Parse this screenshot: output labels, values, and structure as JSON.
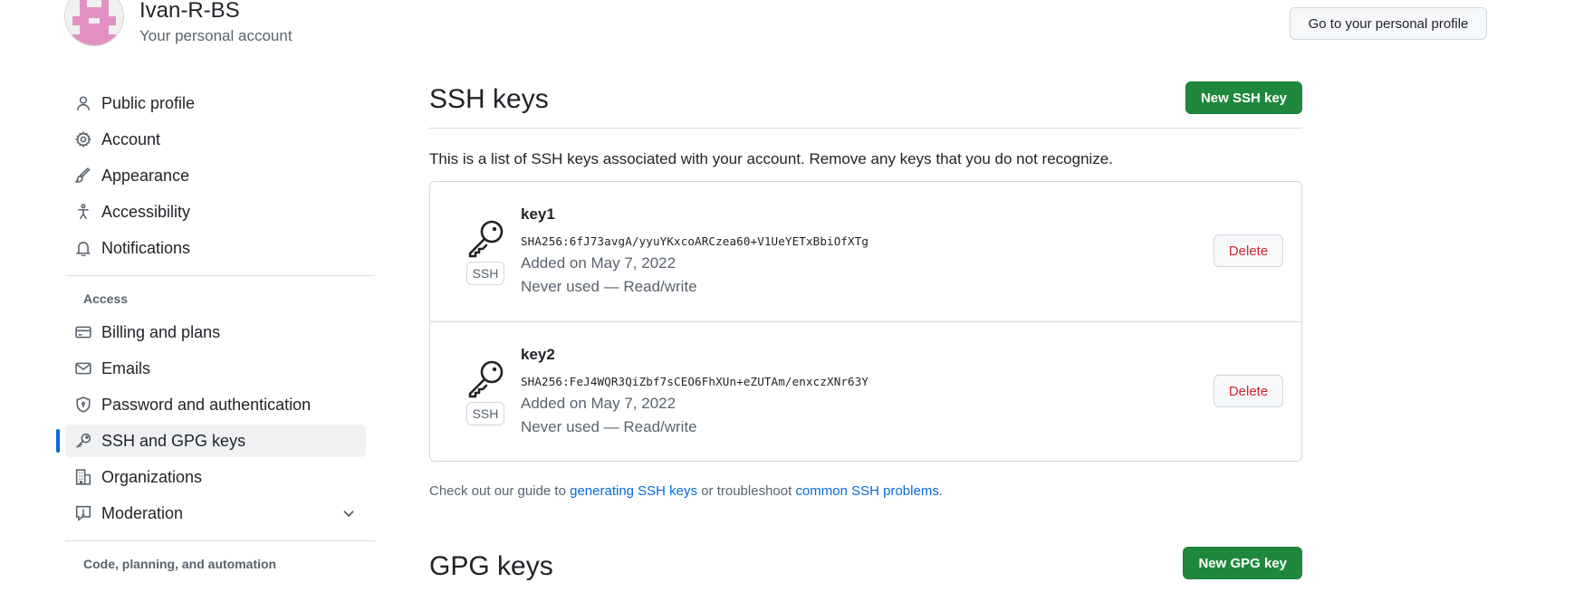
{
  "account": {
    "name": "Ivan-R-BS",
    "subtitle": "Your personal account",
    "profile_button": "Go to your personal profile"
  },
  "sidebar": {
    "items": [
      {
        "label": "Public profile",
        "icon": "person-icon"
      },
      {
        "label": "Account",
        "icon": "gear-icon"
      },
      {
        "label": "Appearance",
        "icon": "paintbrush-icon"
      },
      {
        "label": "Accessibility",
        "icon": "accessibility-icon"
      },
      {
        "label": "Notifications",
        "icon": "bell-icon"
      }
    ],
    "access_heading": "Access",
    "access_items": [
      {
        "label": "Billing and plans",
        "icon": "credit-card-icon"
      },
      {
        "label": "Emails",
        "icon": "mail-icon"
      },
      {
        "label": "Password and authentication",
        "icon": "shield-lock-icon"
      },
      {
        "label": "SSH and GPG keys",
        "icon": "key-icon",
        "active": true
      },
      {
        "label": "Organizations",
        "icon": "organization-icon"
      },
      {
        "label": "Moderation",
        "icon": "report-icon",
        "expandable": true
      }
    ],
    "code_heading": "Code, planning, and automation"
  },
  "ssh": {
    "title": "SSH keys",
    "new_button": "New SSH key",
    "intro": "This is a list of SSH keys associated with your account. Remove any keys that you do not recognize.",
    "keys": [
      {
        "name": "key1",
        "fingerprint": "SHA256:6fJ73avgA/yyuYKxcoARCzea60+V1UeYETxBbiOfXTg",
        "added": "Added on May 7, 2022",
        "usage": "Never used — Read/write",
        "badge": "SSH",
        "delete_label": "Delete"
      },
      {
        "name": "key2",
        "fingerprint": "SHA256:FeJ4WQR3QiZbf7sCEO6FhXUn+eZUTAm/enxczXNr63Y",
        "added": "Added on May 7, 2022",
        "usage": "Never used — Read/write",
        "badge": "SSH",
        "delete_label": "Delete"
      }
    ],
    "guide": {
      "prefix": "Check out our guide to ",
      "link1": "generating SSH keys",
      "middle": " or troubleshoot ",
      "link2": "common SSH problems",
      "suffix": "."
    }
  },
  "gpg": {
    "title": "GPG keys",
    "new_button": "New GPG key"
  },
  "colors": {
    "primary_green": "#1f883d",
    "danger_red": "#cf222e",
    "link_blue": "#0969da",
    "active_indicator": "#0969da",
    "avatar_pink": "#e391c3"
  }
}
